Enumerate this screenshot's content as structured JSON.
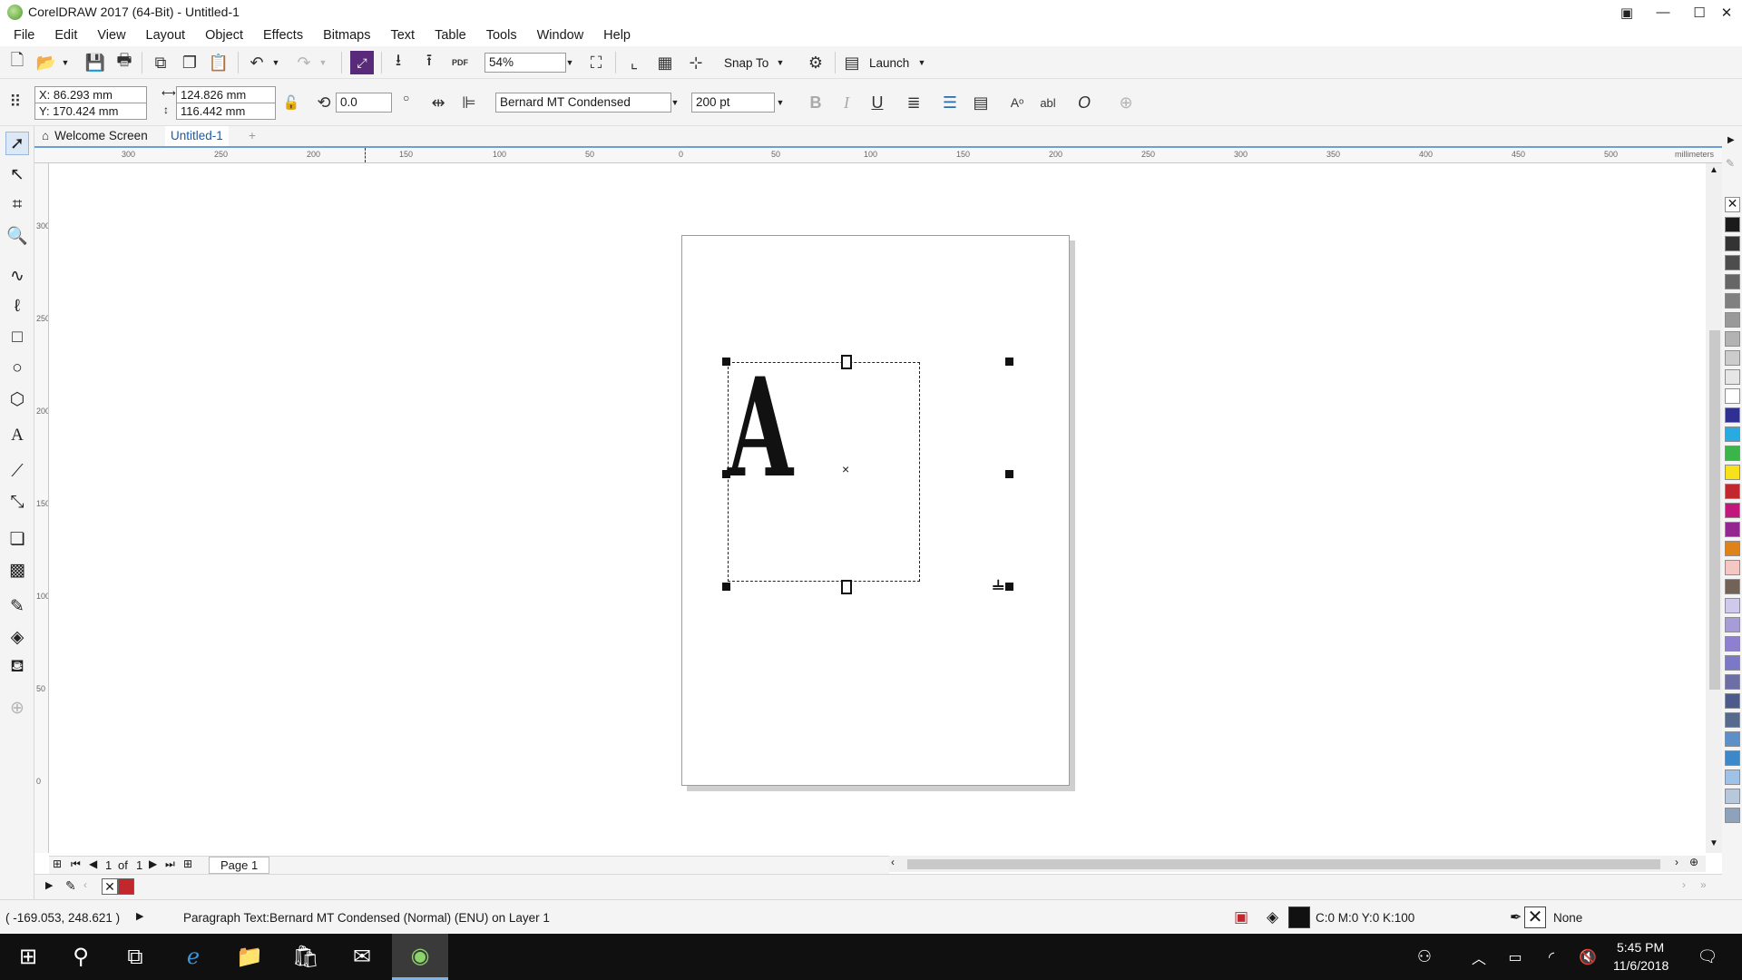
{
  "window": {
    "title": "CorelDRAW 2017 (64-Bit) - Untitled-1",
    "buttons": [
      "—",
      "☐",
      "✕"
    ]
  },
  "menu": [
    "File",
    "Edit",
    "View",
    "Layout",
    "Object",
    "Effects",
    "Bitmaps",
    "Text",
    "Table",
    "Tools",
    "Window",
    "Help"
  ],
  "toolbar": {
    "pdf_label": "PDF",
    "zoom": "54%",
    "snap_to": "Snap To",
    "launch": "Launch"
  },
  "property_bar": {
    "x": "X: 86.293 mm",
    "y": "Y: 170.424 mm",
    "width": "124.826 mm",
    "height": "116.442 mm",
    "rotation": "0.0",
    "font_name": "Bernard MT Condensed",
    "font_size": "200 pt",
    "bold": "B",
    "italic": "I",
    "underline": "U",
    "text_props": "abl"
  },
  "tabs": {
    "welcome": "Welcome Screen",
    "document": "Untitled-1"
  },
  "ruler": {
    "unit": "millimeters",
    "h_ticks": [
      "300",
      "250",
      "200",
      "150",
      "100",
      "50",
      "0",
      "50",
      "100",
      "150",
      "200",
      "250",
      "300",
      "350",
      "400",
      "450",
      "500"
    ],
    "v_ticks": [
      "300",
      "250",
      "200",
      "150",
      "100",
      "50",
      "0"
    ]
  },
  "canvas": {
    "text_glyph": "A",
    "center_mark": "×"
  },
  "page_nav": {
    "current": "1",
    "of": "of",
    "total": "1",
    "page_tab": "Page 1"
  },
  "status": {
    "cursor": "( -169.053, 248.621 )",
    "object_info": "Paragraph Text:Bernard MT Condensed (Normal) (ENU) on Layer 1",
    "fill_color": "C:0 M:0 Y:0 K:100",
    "outline": "None"
  },
  "taskbar": {
    "time": "5:45 PM",
    "date": "11/6/2018"
  },
  "palette_colors": [
    "#1a1a1a",
    "#333333",
    "#4d4d4d",
    "#666666",
    "#808080",
    "#999999",
    "#b3b3b3",
    "#cccccc",
    "#e6e6e6",
    "#ffffff",
    "#2e3192",
    "#29abe2",
    "#39b54a",
    "#f7e11c",
    "#c1272d",
    "#c2187e",
    "#93278f",
    "#e0821a",
    "#f4c7c3",
    "#736357",
    "#cfc9ec",
    "#a89bd9",
    "#8f7fd0",
    "#7b78c8",
    "#6e6ea6",
    "#4d5a8c",
    "#556a8c",
    "#5d8fc9",
    "#3d88c8",
    "#9fc3e6",
    "#b8c8dc",
    "#8da3bd"
  ],
  "accent_color": "#6d9fd6"
}
